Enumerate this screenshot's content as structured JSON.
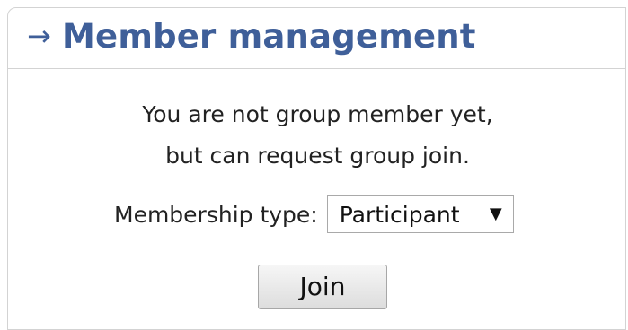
{
  "panel": {
    "arrow_symbol": "→",
    "title": "Member management"
  },
  "message": {
    "line1": "You are not group member yet,",
    "line2": "but can request group join."
  },
  "membership": {
    "label": "Membership type:",
    "selected_value": "Participant",
    "dropdown_icon": "▼"
  },
  "actions": {
    "join_label": "Join"
  },
  "colors": {
    "title": "#3f5f99",
    "text": "#222222",
    "border": "#d3d3d3"
  },
  "icons": {
    "title_arrow": "right-arrow-icon",
    "select_arrow": "chevron-down-icon"
  }
}
